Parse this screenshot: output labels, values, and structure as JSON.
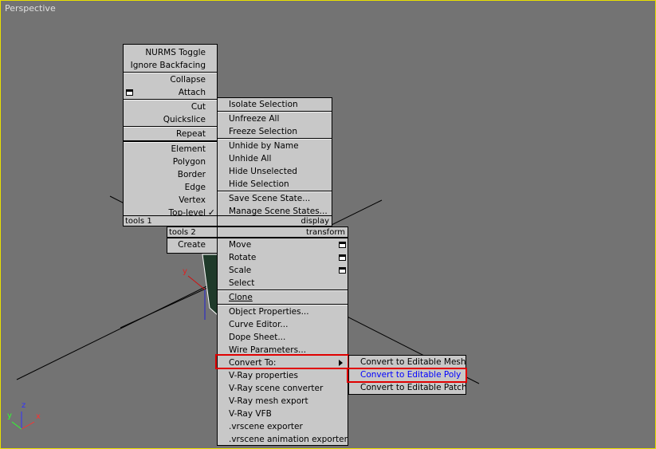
{
  "viewport": {
    "label": "Perspective"
  },
  "axes": {
    "x": "x",
    "y": "y",
    "z": "z",
    "gizmo_y": "y"
  },
  "quad_top_left": {
    "items": [
      "NURMS Toggle",
      "Ignore Backfacing",
      "Collapse",
      "Attach",
      "Cut",
      "Quickslice",
      "Repeat",
      "Element",
      "Polygon",
      "Border",
      "Edge",
      "Vertex",
      "Top-level"
    ],
    "header": "tools 1",
    "checkmark": "✓"
  },
  "quad_top_right": {
    "items": [
      "Isolate Selection",
      "Unfreeze All",
      "Freeze Selection",
      "Unhide by Name",
      "Unhide All",
      "Hide Unselected",
      "Hide Selection",
      "Save Scene State...",
      "Manage Scene States..."
    ],
    "header": "display"
  },
  "quad_bottom_left": {
    "header": "tools 2",
    "items": [
      "Create"
    ]
  },
  "quad_bottom_right": {
    "header": "transform",
    "items": [
      "Move",
      "Rotate",
      "Scale",
      "Select",
      "Clone",
      "Object Properties...",
      "Curve Editor...",
      "Dope Sheet...",
      "Wire Parameters...",
      "Convert To:",
      "V-Ray properties",
      "V-Ray scene converter",
      "V-Ray mesh export",
      "V-Ray VFB",
      ".vrscene exporter",
      ".vrscene animation exporter"
    ]
  },
  "submenu": {
    "items": [
      "Convert to Editable Mesh",
      "Convert to Editable Poly",
      "Convert to Editable Patch"
    ],
    "selected_index": 1
  },
  "colors": {
    "highlight_text": "#0000ff",
    "outline": "#e00000",
    "viewport_border": "#e8e000",
    "menu_bg": "#c8c8c8"
  }
}
